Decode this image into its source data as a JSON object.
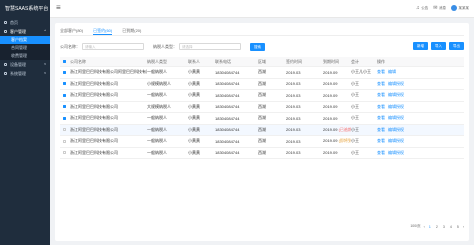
{
  "app": {
    "title": "智慧SAAS系统平台"
  },
  "sidebar": {
    "home": "首页",
    "customer": "客户管理",
    "sub_items": [
      "客户档案",
      "合同管理",
      "收费管理"
    ],
    "section3": "设备管理",
    "section4": "系统管理"
  },
  "topbar": {
    "notice": "公告",
    "message": "消息",
    "user": "某某某"
  },
  "tabs": [
    "全部客户(80)",
    "已签约(60)",
    "已到期(20)"
  ],
  "filters": {
    "company_label": "公司名称：",
    "company_placeholder": "请输入",
    "tax_label": "纳税人类型：",
    "tax_placeholder": "请选择",
    "search": "搜索"
  },
  "actions": [
    "新增",
    "导入",
    "导出"
  ],
  "table": {
    "headers": [
      "公司名称",
      "纳税人类型",
      "联系人",
      "联系电话",
      "区域",
      "签约时间",
      "到期时间",
      "会计",
      "操作"
    ],
    "rows": [
      {
        "checked": true,
        "company": "浙江阿里巴巴科技有限公司阿里巴巴科技有限公司",
        "tax": "一般纳税人",
        "contact": "小黄黄",
        "phone": "18304084744",
        "region": "西湖",
        "sign": "2019.03",
        "expire": "2019.09",
        "accountant": "小王儿小王",
        "ops": [
          "查看",
          "编辑"
        ]
      },
      {
        "checked": true,
        "company": "浙江阿里巴巴科技有限公司",
        "tax": "小规模纳税人",
        "contact": "小黄黄",
        "phone": "18304084744",
        "region": "西湖",
        "sign": "2019.03",
        "expire": "2019.09",
        "accountant": "小王",
        "ops": [
          "查看",
          "编辑授权"
        ]
      },
      {
        "checked": true,
        "company": "浙江阿里巴巴科技有限公司",
        "tax": "一般纳税人",
        "contact": "小黄黄",
        "phone": "18304084744",
        "region": "西湖",
        "sign": "2019.03",
        "expire": "2019.09",
        "accountant": "小王",
        "ops": [
          "查看",
          "编辑授权"
        ]
      },
      {
        "checked": true,
        "company": "浙江阿里巴巴科技有限公司",
        "tax": "大规模纳税人",
        "contact": "小黄黄",
        "phone": "18304084744",
        "region": "西湖",
        "sign": "2019.03",
        "expire": "2019.09",
        "accountant": "小王",
        "ops": [
          "查看",
          "编辑授权"
        ]
      },
      {
        "checked": true,
        "company": "浙江阿里巴巴科技有限公司",
        "tax": "一般纳税人",
        "contact": "小黄黄",
        "phone": "18304084744",
        "region": "西湖",
        "sign": "2019.03",
        "expire": "2019.09",
        "accountant": "小王",
        "ops": [
          "查看",
          "编辑授权"
        ]
      },
      {
        "checked": false,
        "company": "浙江阿里巴巴科技有限公司",
        "tax": "一般纳税人",
        "contact": "小黄黄",
        "phone": "18304084744",
        "region": "西湖",
        "sign": "2019.03",
        "expire": "2019.09",
        "badge": "(已逾期)",
        "accountant": "小王",
        "ops": [
          "查看",
          "编辑授权"
        ]
      },
      {
        "checked": false,
        "company": "浙江阿里巴巴科技有限公司",
        "tax": "一般纳税人",
        "contact": "小黄黄",
        "phone": "18304084744",
        "region": "西湖",
        "sign": "2019.03",
        "expire": "2019.09",
        "badge": "(即将到期)",
        "accountant": "小王",
        "ops": [
          "查看",
          "编辑授权"
        ]
      },
      {
        "checked": false,
        "company": "浙江阿里巴巴科技有限公司",
        "tax": "一般纳税人",
        "contact": "小黄黄",
        "phone": "18304084744",
        "region": "西湖",
        "sign": "2019.03",
        "expire": "2019.09",
        "accountant": "小王",
        "ops": [
          "查看",
          "编辑授权"
        ]
      }
    ]
  },
  "pagination": {
    "total": "100/页",
    "pages": [
      "1",
      "2",
      "3",
      "4",
      "5"
    ],
    "current": "1"
  },
  "colors": {
    "primary": "#1890ff",
    "sidebar": "#1f2d3d",
    "warning": "#e6a23c",
    "danger": "#f56c6c"
  }
}
